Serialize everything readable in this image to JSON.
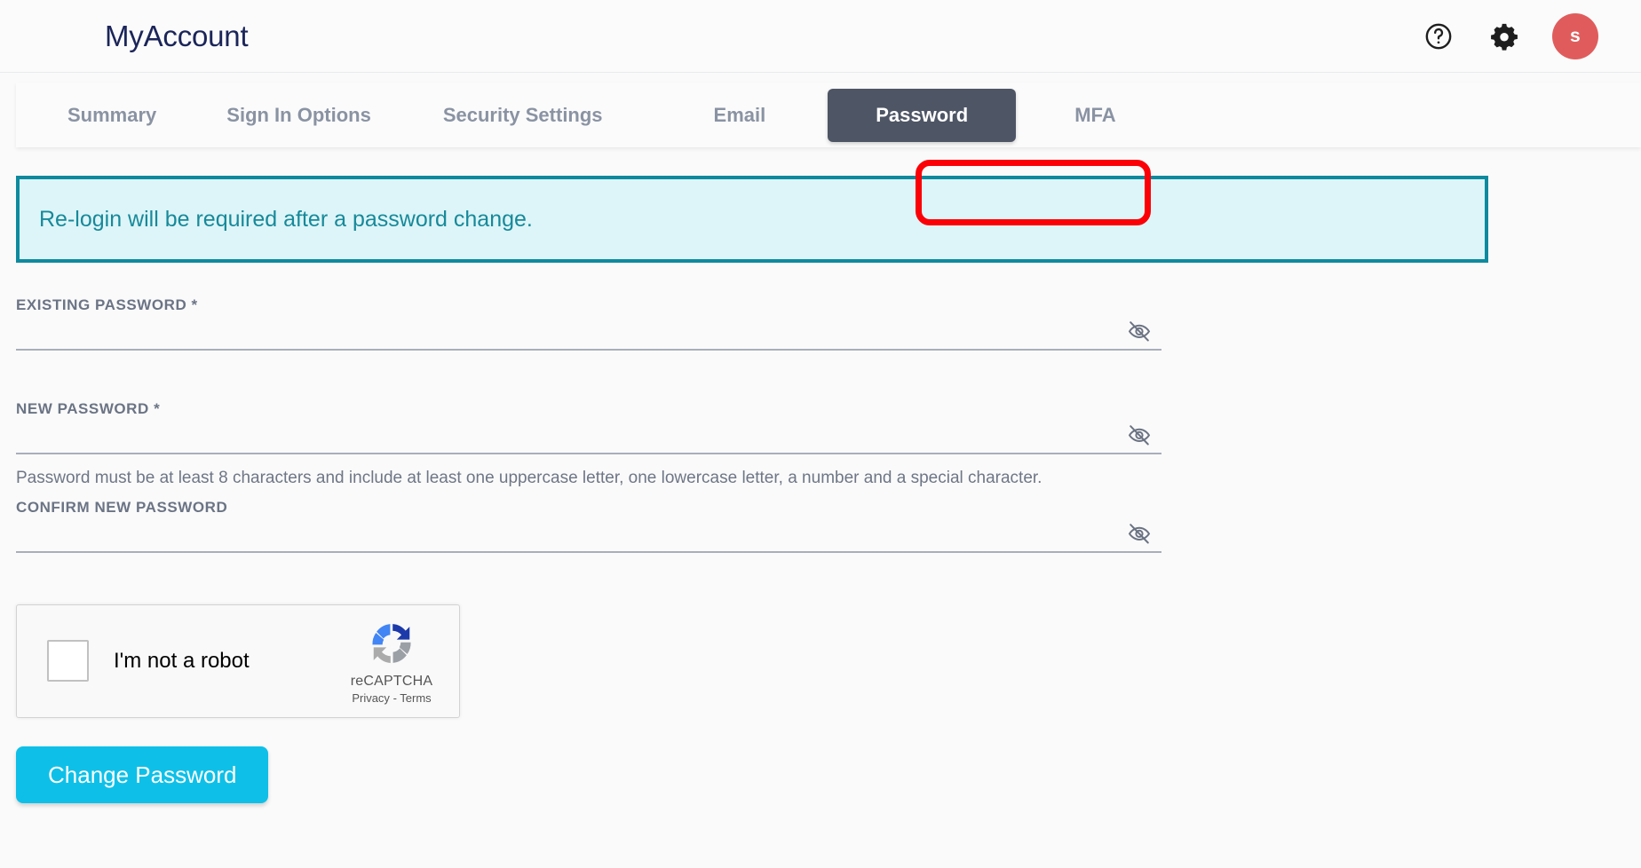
{
  "header": {
    "brand": "MyAccount",
    "help_icon": "help-circle-icon",
    "settings_icon": "gear-icon",
    "avatar_initial": "s",
    "avatar_color": "#e05c5c"
  },
  "tabs": [
    {
      "label": "Summary",
      "active": false
    },
    {
      "label": "Sign In Options",
      "active": false
    },
    {
      "label": "Security Settings",
      "active": false
    },
    {
      "label": "Email",
      "active": false
    },
    {
      "label": "Password",
      "active": true
    },
    {
      "label": "MFA",
      "active": false
    }
  ],
  "annotation": {
    "target": "Password",
    "color": "#fb0007"
  },
  "banner": {
    "text": "Re-login will be required after a password change.",
    "background": "#ddf5f8",
    "border_color": "#0e8a9e",
    "text_color": "#17899a"
  },
  "form": {
    "existing_password": {
      "label": "EXISTING PASSWORD *",
      "value": "",
      "placeholder": "",
      "toggle_icon": "eye-off-icon"
    },
    "new_password": {
      "label": "NEW PASSWORD *",
      "value": "",
      "placeholder": "",
      "toggle_icon": "eye-off-icon",
      "helper": "Password must be at least 8 characters and include at least one uppercase letter, one lowercase letter, a number and a special character."
    },
    "confirm_password": {
      "label": "CONFIRM NEW PASSWORD",
      "value": "",
      "placeholder": "",
      "toggle_icon": "eye-off-icon"
    }
  },
  "recaptcha": {
    "checkbox_label": "I'm not a robot",
    "brand_name": "reCAPTCHA",
    "privacy_label": "Privacy",
    "separator": "-",
    "terms_label": "Terms",
    "checked": false
  },
  "actions": {
    "submit_label": "Change Password",
    "submit_color": "#0ec0e8"
  }
}
